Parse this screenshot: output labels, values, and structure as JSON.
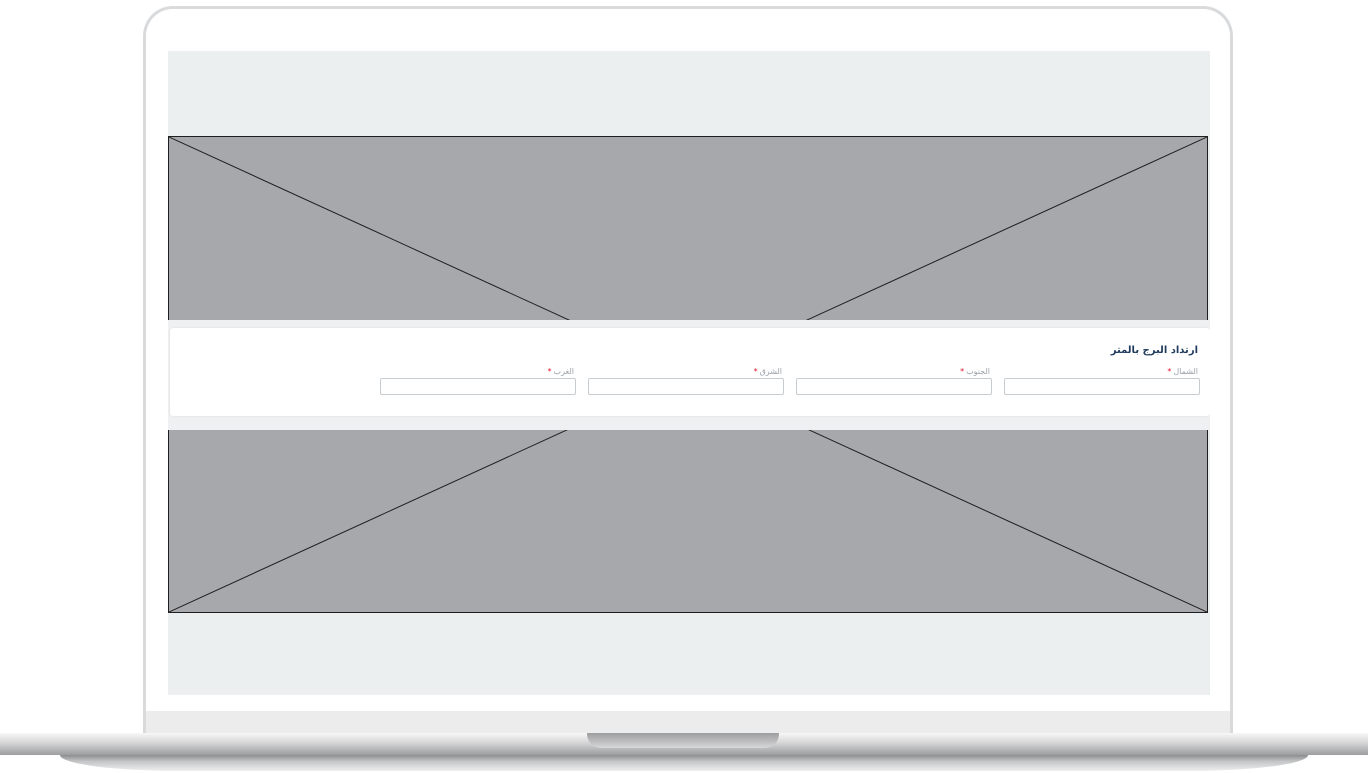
{
  "form": {
    "title": "ارتداد البرج بالمتر",
    "required_marker": "*",
    "fields": [
      {
        "label": "الشمال",
        "value": "",
        "placeholder": ""
      },
      {
        "label": "الجنوب",
        "value": "",
        "placeholder": ""
      },
      {
        "label": "الشرق",
        "value": "",
        "placeholder": ""
      },
      {
        "label": "الغرب",
        "value": "",
        "placeholder": ""
      }
    ]
  },
  "colors": {
    "title": "#1f3a5c",
    "required": "#e0182d",
    "placeholder_fill": "#a7a8ab",
    "screen_background": "#eceff0"
  }
}
